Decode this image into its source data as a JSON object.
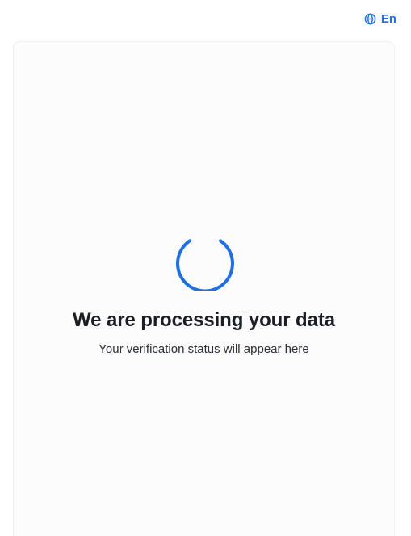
{
  "header": {
    "language_label": "En",
    "language_icon": "globe-icon"
  },
  "status": {
    "spinner_icon": "loading-spinner-icon",
    "title": "We are processing your data",
    "subtitle": "Your verification status will appear here"
  },
  "colors": {
    "accent": "#1f6fe5",
    "title_text": "#1b1e24",
    "body_text": "#2a2f38",
    "card_background": "#fcfcfd",
    "card_border": "#eef0f3"
  }
}
